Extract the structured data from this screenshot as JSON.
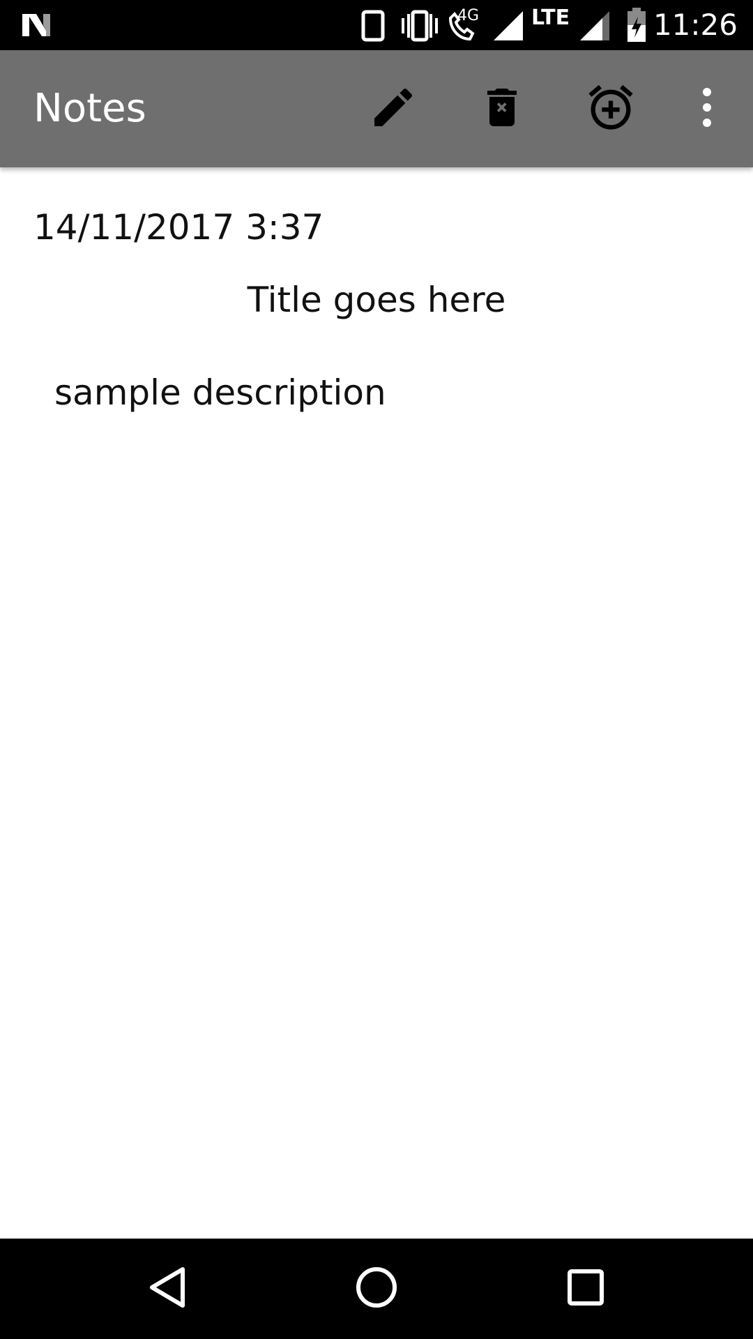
{
  "status_bar": {
    "time": "11:26",
    "network_label": "LTE",
    "call_network_label": "4G",
    "icons": [
      "n-logo-icon",
      "phone-outline-icon",
      "vibrate-icon",
      "wifi-call-icon",
      "signal-icon",
      "lte-signal-icon",
      "battery-charging-icon"
    ]
  },
  "app_bar": {
    "title": "Notes",
    "actions": [
      "edit-icon",
      "delete-icon",
      "add-alarm-icon",
      "more-vert-icon"
    ],
    "background_color": "#6f6f6f"
  },
  "note": {
    "date": "14/11/2017 3:37",
    "title": "Title goes here",
    "description": "sample description"
  },
  "nav_bar": {
    "buttons": [
      "back-icon",
      "home-icon",
      "recents-icon"
    ]
  }
}
